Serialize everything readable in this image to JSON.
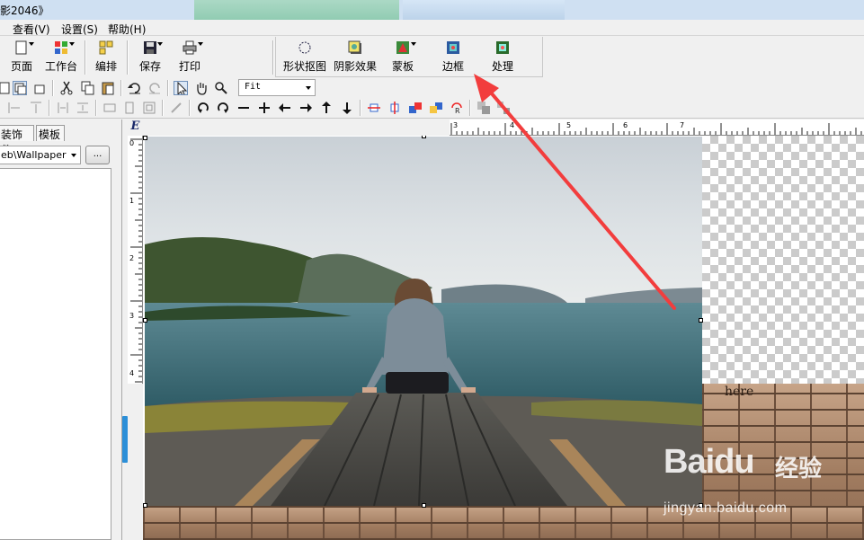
{
  "window": {
    "title": "影2046》"
  },
  "menubar": {
    "items": [
      "查看(V)",
      "设置(S)",
      "帮助(H)"
    ]
  },
  "toolbar": {
    "page_label": "页面",
    "workbench_label": "工作台",
    "layout_label": "编排",
    "save_label": "保存",
    "print_label": "打印",
    "shape_crop_label": "形状抠图",
    "shadow_label": "阴影效果",
    "mask_label": "蒙板",
    "border_label": "边框",
    "process_label": "处理"
  },
  "zoom": {
    "value": "Fit"
  },
  "panel": {
    "tabs": [
      "装饰件",
      "模板"
    ],
    "path_value": "eb\\Wallpaper",
    "browse_label": "..."
  },
  "ruler": {
    "corner": "E",
    "h_labels": [
      "3",
      "4",
      "5",
      "6",
      "7"
    ],
    "v_labels": [
      "0",
      "1",
      "2",
      "3",
      "4"
    ]
  },
  "canvas": {
    "brick_text": "here"
  },
  "watermark": {
    "brand": "Bai",
    "brand_suffix": "du",
    "product": "经验",
    "url": "jingyan.baidu.com"
  },
  "colors": {
    "arrow": "#f23d3d",
    "selection": "#dbe7f5",
    "splitter": "#2c8fd8"
  }
}
